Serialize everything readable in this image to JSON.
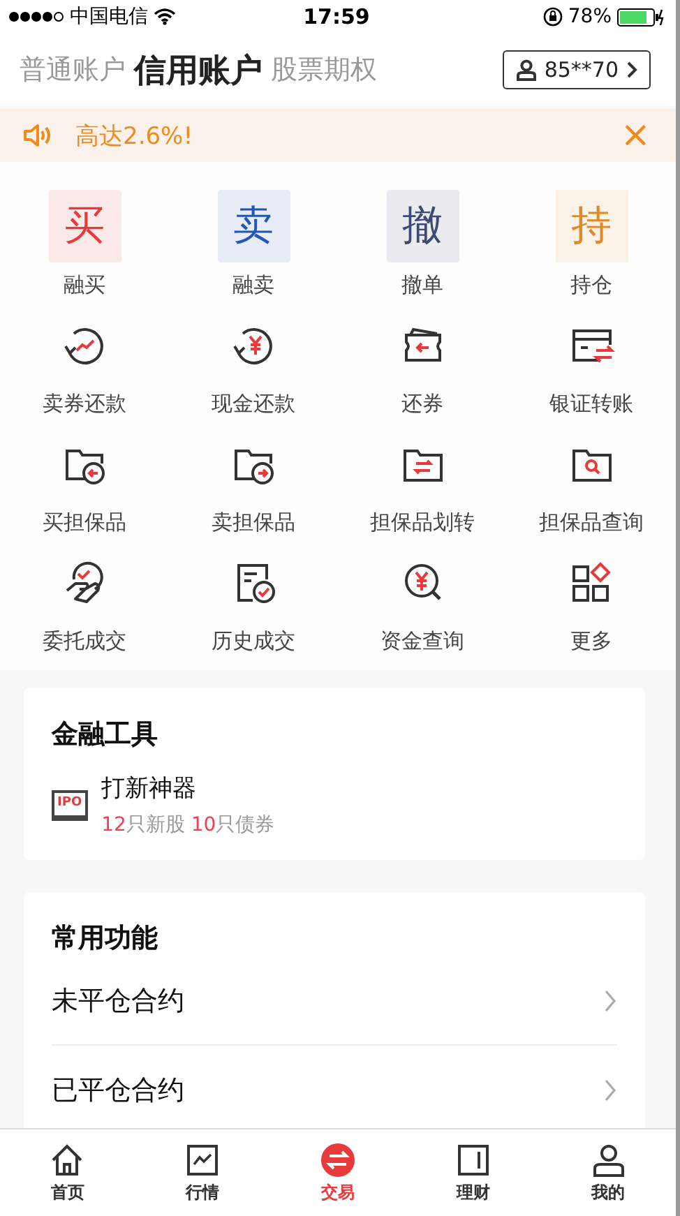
{
  "status_bar": {
    "carrier": "中国电信",
    "time": "17:59",
    "battery": "78%"
  },
  "account_tabs": [
    {
      "label": "普通账户",
      "selected": false
    },
    {
      "label": "信用账户",
      "selected": true
    },
    {
      "label": "股票期权",
      "selected": false
    }
  ],
  "account_button": {
    "label": "85**70"
  },
  "banner": {
    "text": "高达2.6%!",
    "close": "×"
  },
  "functions": [
    {
      "kind": "tile",
      "glyph": "买",
      "color": "#e83a3a",
      "label": "融买"
    },
    {
      "kind": "tile",
      "glyph": "卖",
      "color": "#2456b8",
      "label": "融卖"
    },
    {
      "kind": "tile",
      "glyph": "撤",
      "color": "#3d4a73",
      "label": "撤单"
    },
    {
      "kind": "tile",
      "glyph": "持",
      "color": "#e0892a",
      "label": "持仓"
    },
    {
      "kind": "icon",
      "label": "卖券还款"
    },
    {
      "kind": "icon",
      "label": "现金还款"
    },
    {
      "kind": "icon",
      "label": "还券"
    },
    {
      "kind": "icon",
      "label": "银证转账"
    },
    {
      "kind": "icon",
      "label": "买担保品"
    },
    {
      "kind": "icon",
      "label": "卖担保品"
    },
    {
      "kind": "icon",
      "label": "担保品划转"
    },
    {
      "kind": "icon",
      "label": "担保品查询"
    },
    {
      "kind": "icon",
      "label": "委托成交"
    },
    {
      "kind": "icon",
      "label": "历史成交"
    },
    {
      "kind": "icon",
      "label": "资金查询"
    },
    {
      "kind": "icon",
      "label": "更多"
    }
  ],
  "tools_card": {
    "title": "金融工具",
    "items": [
      {
        "badge": "IPO",
        "title": "打新神器",
        "subtitle": [
          {
            "text": "12",
            "highlight": true
          },
          {
            "text": "只新股 ",
            "highlight": false
          },
          {
            "text": "10",
            "highlight": true
          },
          {
            "text": "只债券",
            "highlight": false
          }
        ]
      }
    ]
  },
  "common_card": {
    "title": "常用功能",
    "items": [
      {
        "label": "未平仓合约"
      },
      {
        "label": "已平仓合约"
      }
    ]
  },
  "tab_bar": [
    {
      "label": "首页",
      "selected": false
    },
    {
      "label": "行情",
      "selected": false
    },
    {
      "label": "交易",
      "selected": true
    },
    {
      "label": "理财",
      "selected": false
    },
    {
      "label": "我的",
      "selected": false
    }
  ]
}
